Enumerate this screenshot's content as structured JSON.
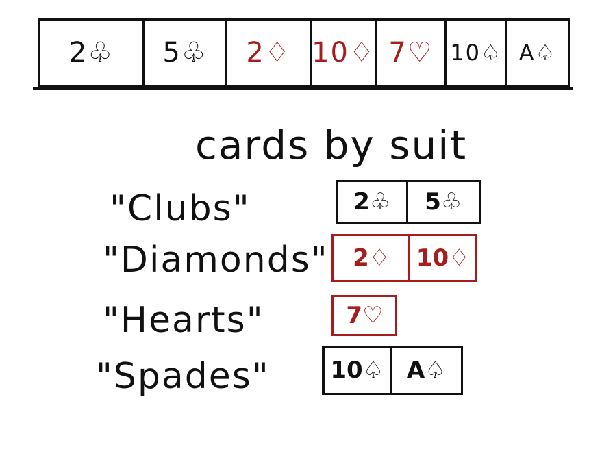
{
  "card_row": [
    {
      "text": "2♧",
      "color": "#111111"
    },
    {
      "text": "5♧",
      "color": "#111111"
    },
    {
      "text": "2♢",
      "color": "#a51d1d"
    },
    {
      "text": "10♢",
      "color": "#a51d1d"
    },
    {
      "text": "7♡",
      "color": "#a51d1d"
    },
    {
      "text": "10♤",
      "color": "#111111"
    },
    {
      "text": "A♤",
      "color": "#111111"
    }
  ],
  "title": "cards by suit",
  "groups": [
    {
      "label": "\"Clubs\"",
      "color": "#111111",
      "cards": [
        "2♧",
        "5♧"
      ]
    },
    {
      "label": "\"Diamonds\"",
      "color": "#a51d1d",
      "cards": [
        "2♢",
        "10♢"
      ]
    },
    {
      "label": "\"Hearts\"",
      "color": "#a51d1d",
      "cards": [
        "7♡"
      ]
    },
    {
      "label": "\"Spades\"",
      "color": "#111111",
      "cards": [
        "10♤",
        "A♤"
      ]
    }
  ]
}
